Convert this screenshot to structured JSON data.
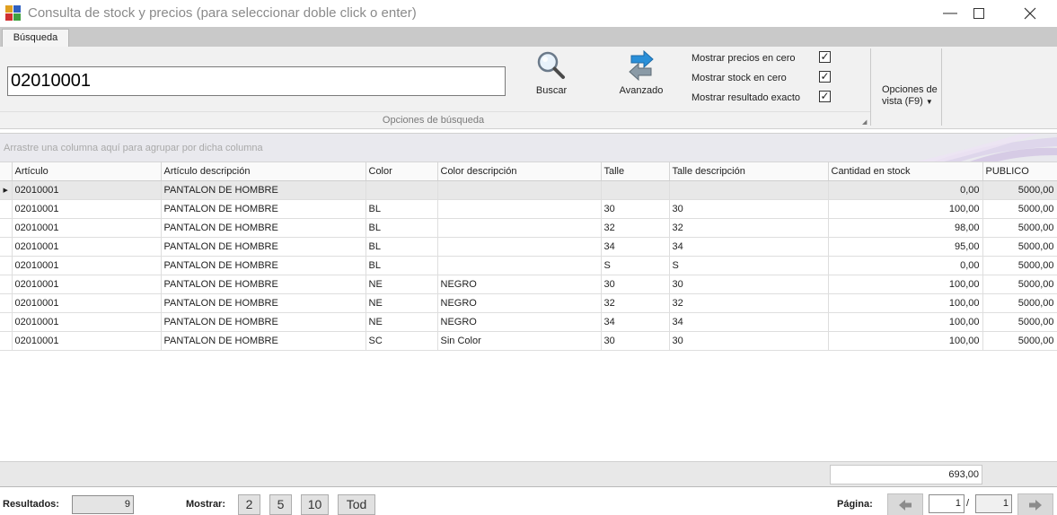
{
  "window": {
    "title": "Consulta de stock y precios (para seleccionar doble click o enter)"
  },
  "ribbon": {
    "tab": "Búsqueda",
    "search_value": "02010001",
    "buscar_label": "Buscar",
    "avanzado_label": "Avanzado",
    "group_label": "Opciones de búsqueda",
    "options": [
      {
        "label": "Mostrar precios en cero",
        "checked": true
      },
      {
        "label": "Mostrar stock en cero",
        "checked": true
      },
      {
        "label": "Mostrar resultado exacto",
        "checked": true
      }
    ],
    "vista_line1": "Opciones de",
    "vista_line2": "vista (F9)"
  },
  "group_panel": {
    "hint": "Arrastre una columna aquí para agrupar por dicha columna"
  },
  "grid": {
    "columns": [
      "Artículo",
      "Artículo descripción",
      "Color",
      "Color descripción",
      "Talle",
      "Talle descripción",
      "Cantidad en stock",
      "PUBLICO"
    ],
    "rows": [
      [
        "02010001",
        "PANTALON DE HOMBRE",
        "",
        "",
        "",
        "",
        "0,00",
        "5000,00"
      ],
      [
        "02010001",
        "PANTALON DE HOMBRE",
        "BL",
        "",
        "30",
        "30",
        "100,00",
        "5000,00"
      ],
      [
        "02010001",
        "PANTALON DE HOMBRE",
        "BL",
        "",
        "32",
        "32",
        "98,00",
        "5000,00"
      ],
      [
        "02010001",
        "PANTALON DE HOMBRE",
        "BL",
        "",
        "34",
        "34",
        "95,00",
        "5000,00"
      ],
      [
        "02010001",
        "PANTALON DE HOMBRE",
        "BL",
        "",
        "S",
        "S",
        "0,00",
        "5000,00"
      ],
      [
        "02010001",
        "PANTALON DE HOMBRE",
        "NE",
        "NEGRO",
        "30",
        "30",
        "100,00",
        "5000,00"
      ],
      [
        "02010001",
        "PANTALON DE HOMBRE",
        "NE",
        "NEGRO",
        "32",
        "32",
        "100,00",
        "5000,00"
      ],
      [
        "02010001",
        "PANTALON DE HOMBRE",
        "NE",
        "NEGRO",
        "34",
        "34",
        "100,00",
        "5000,00"
      ],
      [
        "02010001",
        "PANTALON DE HOMBRE",
        "SC",
        "Sin Color",
        "30",
        "30",
        "100,00",
        "5000,00"
      ]
    ],
    "total_stock": "693,00"
  },
  "status": {
    "resultados_label": "Resultados:",
    "resultados_value": "9",
    "mostrar_label": "Mostrar:",
    "mostrar_options": [
      "2",
      "5",
      "10",
      "Tod"
    ],
    "pagina_label": "Página:",
    "pagina_current": "1",
    "pagina_sep": "/",
    "pagina_total": "1"
  },
  "colors": {
    "accent_blue": "#2a8fd8",
    "arrow_green": "#3c9e4b",
    "ribbon_bg": "#f1f1f1"
  }
}
